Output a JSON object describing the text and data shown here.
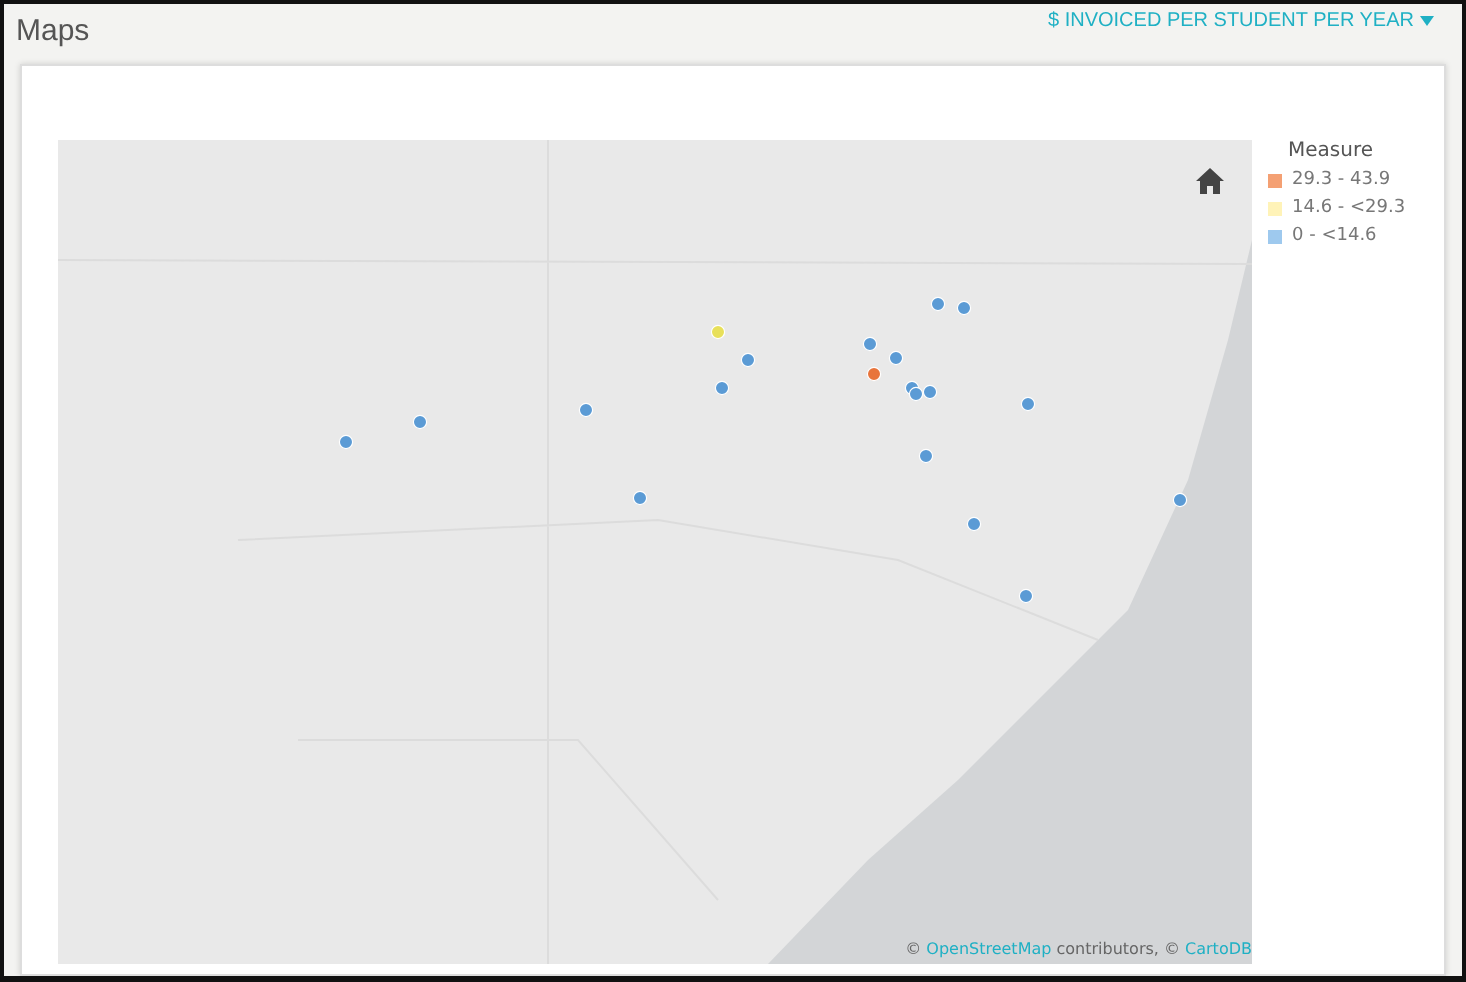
{
  "header": {
    "title": "Maps",
    "measure_dropdown": "$ INVOICED PER STUDENT PER YEAR"
  },
  "legend": {
    "title": "Measure",
    "items": [
      {
        "label": "29.3 - 43.9",
        "color": "#f4a073"
      },
      {
        "label": "14.6 - <29.3",
        "color": "#fff3b8"
      },
      {
        "label": "0 - <14.6",
        "color": "#9ec9ee"
      }
    ]
  },
  "attribution": [
    {
      "kind": "text",
      "text": "© "
    },
    {
      "kind": "link",
      "text": "OpenStreetMap"
    },
    {
      "kind": "text",
      "text": " contributors, © "
    },
    {
      "kind": "link",
      "text": "CartoDB"
    }
  ]
}
